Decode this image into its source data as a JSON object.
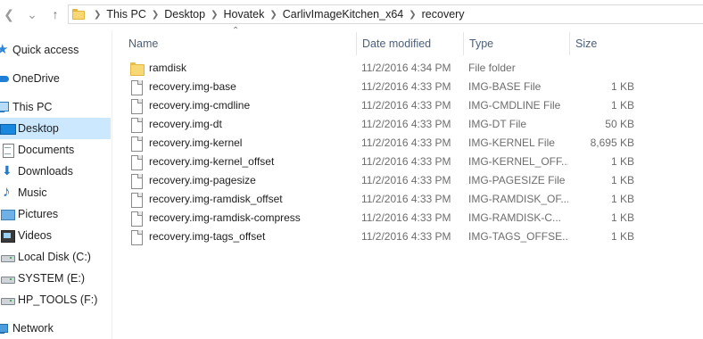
{
  "address_bar": {
    "breadcrumbs": [
      "This PC",
      "Desktop",
      "Hovatek",
      "CarlivImageKitchen_x64",
      "recovery"
    ]
  },
  "nav_pane": {
    "items": [
      {
        "label": "Quick access",
        "icon": "star-icon",
        "selected": false
      },
      {
        "label": "OneDrive",
        "icon": "cloud-icon",
        "selected": false
      },
      {
        "label": "This PC",
        "icon": "computer-icon",
        "selected": false
      },
      {
        "label": "Desktop",
        "icon": "desktop-icon",
        "selected": true
      },
      {
        "label": "Documents",
        "icon": "documents-icon",
        "selected": false
      },
      {
        "label": "Downloads",
        "icon": "download-icon",
        "selected": false
      },
      {
        "label": "Music",
        "icon": "music-icon",
        "selected": false
      },
      {
        "label": "Pictures",
        "icon": "pictures-icon",
        "selected": false
      },
      {
        "label": "Videos",
        "icon": "videos-icon",
        "selected": false
      },
      {
        "label": "Local Disk (C:)",
        "icon": "drive-icon",
        "selected": false
      },
      {
        "label": "SYSTEM (E:)",
        "icon": "drive-icon",
        "selected": false
      },
      {
        "label": "HP_TOOLS (F:)",
        "icon": "drive-icon",
        "selected": false
      },
      {
        "label": "Network",
        "icon": "network-icon",
        "selected": false
      }
    ]
  },
  "file_list": {
    "columns": {
      "name": "Name",
      "date": "Date modified",
      "type": "Type",
      "size": "Size"
    },
    "sorted_by": "name",
    "rows": [
      {
        "name": "ramdisk",
        "date": "11/2/2016 4:34 PM",
        "type": "File folder",
        "size": "",
        "icon": "folder-icon"
      },
      {
        "name": "recovery.img-base",
        "date": "11/2/2016 4:33 PM",
        "type": "IMG-BASE File",
        "size": "1 KB",
        "icon": "file-icon"
      },
      {
        "name": "recovery.img-cmdline",
        "date": "11/2/2016 4:33 PM",
        "type": "IMG-CMDLINE File",
        "size": "1 KB",
        "icon": "file-icon"
      },
      {
        "name": "recovery.img-dt",
        "date": "11/2/2016 4:33 PM",
        "type": "IMG-DT File",
        "size": "50 KB",
        "icon": "file-icon"
      },
      {
        "name": "recovery.img-kernel",
        "date": "11/2/2016 4:33 PM",
        "type": "IMG-KERNEL File",
        "size": "8,695 KB",
        "icon": "file-icon"
      },
      {
        "name": "recovery.img-kernel_offset",
        "date": "11/2/2016 4:33 PM",
        "type": "IMG-KERNEL_OFF...",
        "size": "1 KB",
        "icon": "file-icon"
      },
      {
        "name": "recovery.img-pagesize",
        "date": "11/2/2016 4:33 PM",
        "type": "IMG-PAGESIZE File",
        "size": "1 KB",
        "icon": "file-icon"
      },
      {
        "name": "recovery.img-ramdisk_offset",
        "date": "11/2/2016 4:33 PM",
        "type": "IMG-RAMDISK_OF...",
        "size": "1 KB",
        "icon": "file-icon"
      },
      {
        "name": "recovery.img-ramdisk-compress",
        "date": "11/2/2016 4:33 PM",
        "type": "IMG-RAMDISK-C...",
        "size": "1 KB",
        "icon": "file-icon"
      },
      {
        "name": "recovery.img-tags_offset",
        "date": "11/2/2016 4:33 PM",
        "type": "IMG-TAGS_OFFSE...",
        "size": "1 KB",
        "icon": "file-icon"
      }
    ]
  },
  "colors": {
    "selection": "#cce8ff",
    "header_text": "#4c607a",
    "secondary_text": "#6d6d6d",
    "folder": "#f8d775"
  }
}
